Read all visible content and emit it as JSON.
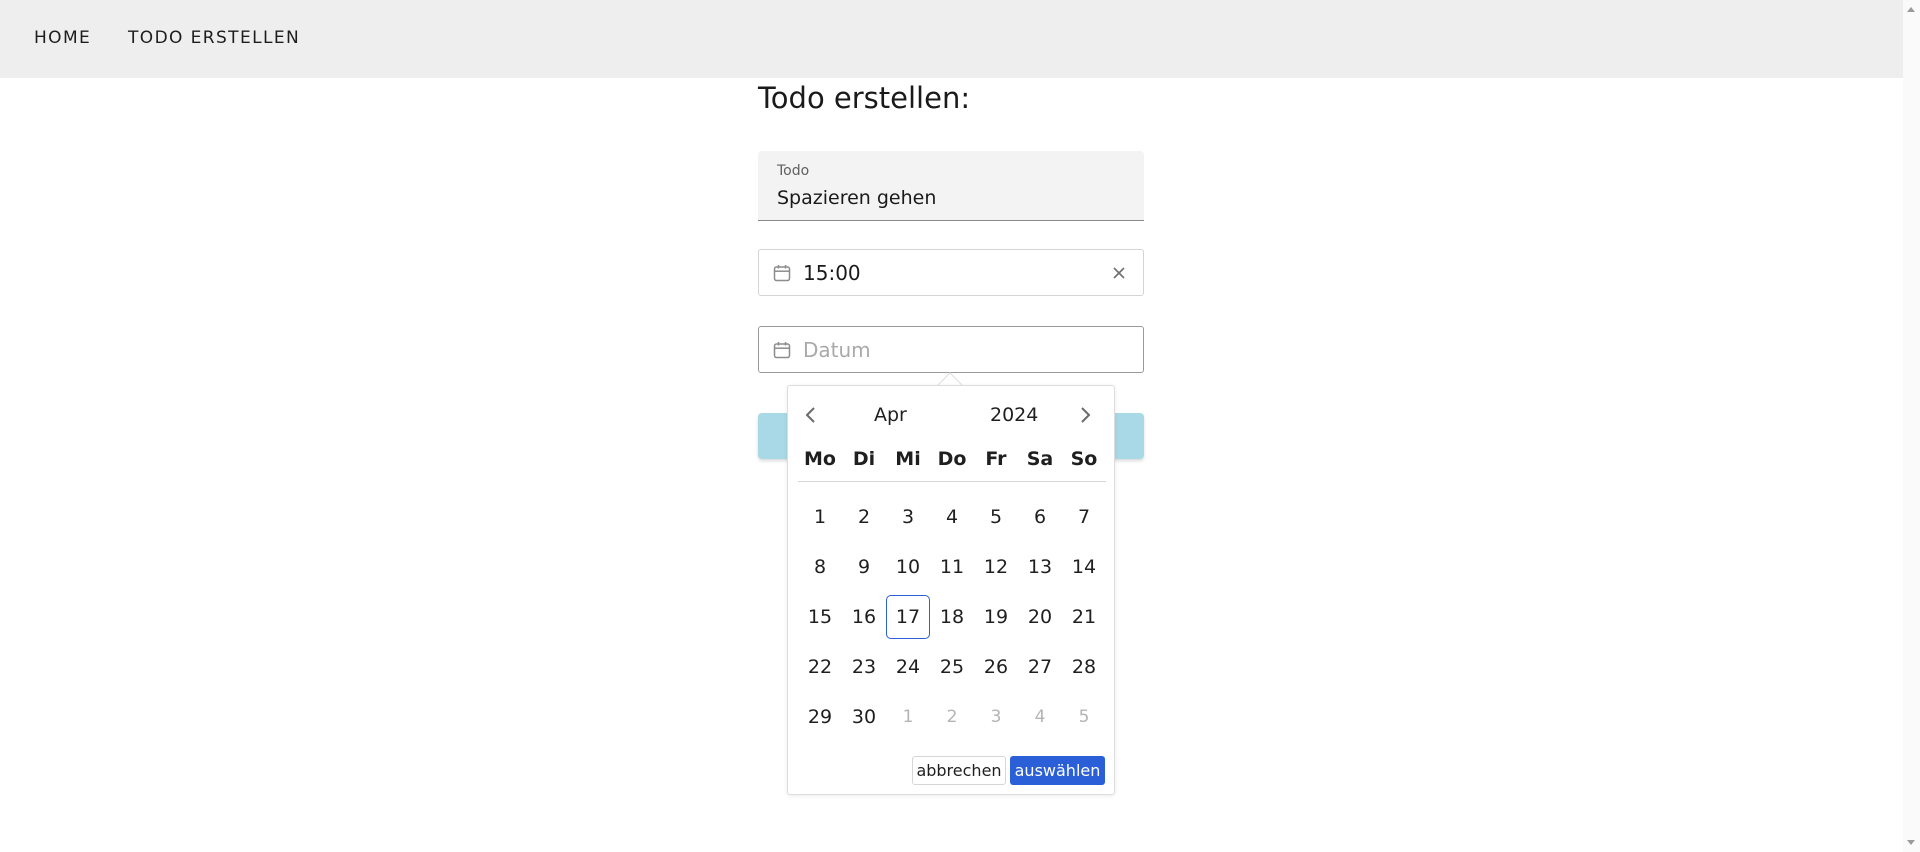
{
  "nav": {
    "home": "HOME",
    "create": "TODO ERSTELLEN"
  },
  "page": {
    "title": "Todo erstellen:"
  },
  "form": {
    "todo": {
      "label": "Todo",
      "value": "Spazieren gehen"
    },
    "time": {
      "value": "15:00",
      "icon": "calendar-icon",
      "clear_icon": "close-icon"
    },
    "date": {
      "placeholder": "Datum",
      "value": "",
      "icon": "calendar-icon"
    },
    "submit_color": "#a9d9e7"
  },
  "datepicker": {
    "month": "Apr",
    "year": "2024",
    "weekdays": [
      "Mo",
      "Di",
      "Mi",
      "Do",
      "Fr",
      "Sa",
      "So"
    ],
    "days": [
      [
        "1",
        "2",
        "3",
        "4",
        "5",
        "6",
        "7"
      ],
      [
        "8",
        "9",
        "10",
        "11",
        "12",
        "13",
        "14"
      ],
      [
        "15",
        "16",
        "17",
        "18",
        "19",
        "20",
        "21"
      ],
      [
        "22",
        "23",
        "24",
        "25",
        "26",
        "27",
        "28"
      ],
      [
        "29",
        "30",
        "1",
        "2",
        "3",
        "4",
        "5"
      ]
    ],
    "today": "17",
    "next_month_days": [
      "1",
      "2",
      "3",
      "4",
      "5"
    ],
    "cancel_label": "abbrechen",
    "select_label": "auswählen",
    "accent_color": "#2a5fd8"
  }
}
